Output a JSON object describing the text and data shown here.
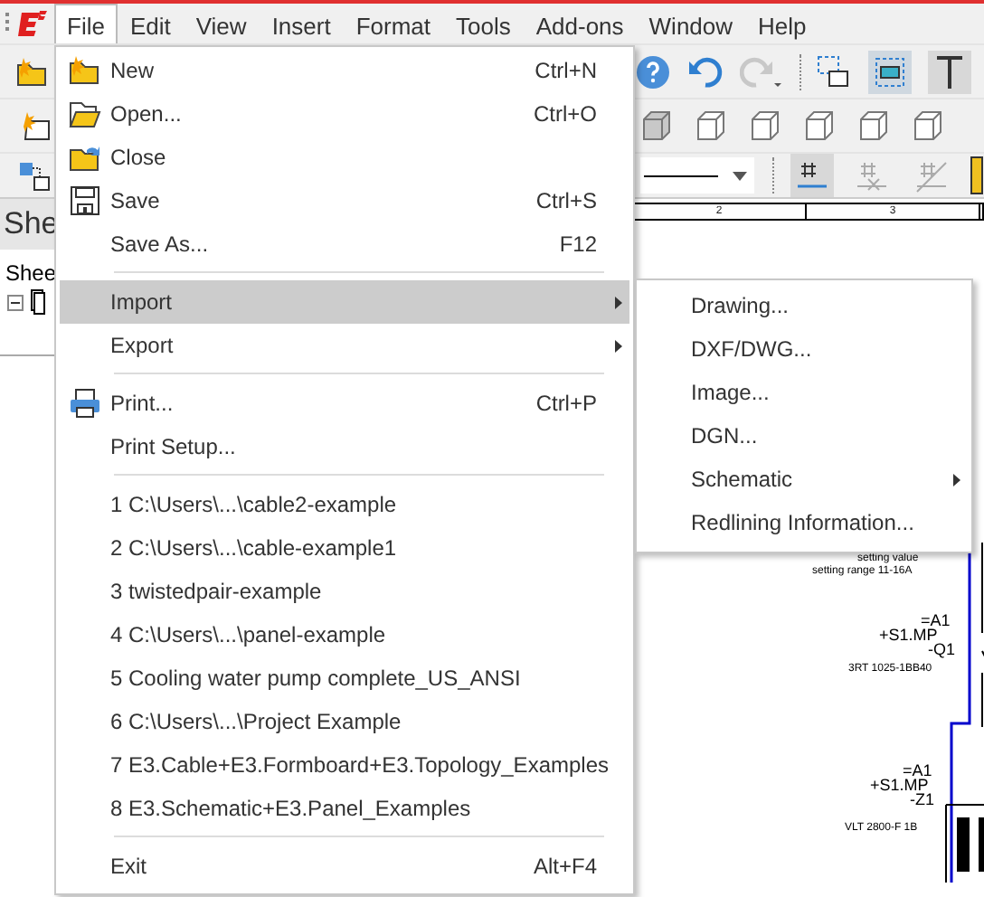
{
  "menubar": [
    {
      "label": "File",
      "selected": true
    },
    {
      "label": "Edit",
      "selected": false
    },
    {
      "label": "View",
      "selected": false
    },
    {
      "label": "Insert",
      "selected": false
    },
    {
      "label": "Format",
      "selected": false
    },
    {
      "label": "Tools",
      "selected": false
    },
    {
      "label": "Add-ons",
      "selected": false
    },
    {
      "label": "Window",
      "selected": false
    },
    {
      "label": "Help",
      "selected": false
    }
  ],
  "side_panel": {
    "title": "She",
    "tab": "Shee"
  },
  "schematic": {
    "ruler": [
      "2",
      "3"
    ],
    "labels": [
      {
        "text": "setting value"
      },
      {
        "text": "setting range 11-16A"
      },
      {
        "text": "=A1"
      },
      {
        "text": "+S1.MP"
      },
      {
        "text": "-Q1"
      },
      {
        "text": "3RT 1025-1BB40"
      },
      {
        "text": "=A1"
      },
      {
        "text": "+S1.MP"
      },
      {
        "text": "-Z1"
      },
      {
        "text": "VLT 2800-F 1B"
      }
    ]
  },
  "file_menu": [
    {
      "kind": "item",
      "label": "New",
      "shortcut": "Ctrl+N",
      "submenu": false,
      "selected": false
    },
    {
      "kind": "item",
      "label": "Open...",
      "shortcut": "Ctrl+O",
      "submenu": false,
      "selected": false
    },
    {
      "kind": "item",
      "label": "Close",
      "submenu": false,
      "selected": false
    },
    {
      "kind": "item",
      "label": "Save",
      "shortcut": "Ctrl+S",
      "submenu": false,
      "selected": false
    },
    {
      "kind": "item",
      "label": "Save As...",
      "shortcut": "F12",
      "submenu": false,
      "selected": false
    },
    {
      "kind": "separator"
    },
    {
      "kind": "item",
      "label": "Import",
      "submenu": true,
      "selected": true
    },
    {
      "kind": "item",
      "label": "Export",
      "submenu": true,
      "selected": false
    },
    {
      "kind": "separator"
    },
    {
      "kind": "item",
      "label": "Print...",
      "shortcut": "Ctrl+P",
      "submenu": false,
      "selected": false
    },
    {
      "kind": "item",
      "label": "Print Setup...",
      "submenu": false,
      "selected": false
    },
    {
      "kind": "separator"
    },
    {
      "kind": "item",
      "label": "1 C:\\Users\\...\\cable2-example",
      "submenu": false,
      "selected": false
    },
    {
      "kind": "item",
      "label": "2 C:\\Users\\...\\cable-example1",
      "submenu": false,
      "selected": false
    },
    {
      "kind": "item",
      "label": "3 twistedpair-example",
      "submenu": false,
      "selected": false
    },
    {
      "kind": "item",
      "label": "4 C:\\Users\\...\\panel-example",
      "submenu": false,
      "selected": false
    },
    {
      "kind": "item",
      "label": "5 Cooling water pump complete_US_ANSI",
      "submenu": false,
      "selected": false
    },
    {
      "kind": "item",
      "label": "6 C:\\Users\\...\\Project Example",
      "submenu": false,
      "selected": false
    },
    {
      "kind": "item",
      "label": "7 E3.Cable+E3.Formboard+E3.Topology_Examples",
      "submenu": false,
      "selected": false
    },
    {
      "kind": "item",
      "label": "8 E3.Schematic+E3.Panel_Examples",
      "submenu": false,
      "selected": false
    },
    {
      "kind": "separator"
    },
    {
      "kind": "item",
      "label": "Exit",
      "shortcut": "Alt+F4",
      "submenu": false,
      "selected": false
    }
  ],
  "import_submenu": [
    {
      "label": "Drawing...",
      "submenu": false
    },
    {
      "label": "DXF/DWG...",
      "submenu": false
    },
    {
      "label": "Image...",
      "submenu": false
    },
    {
      "label": "DGN...",
      "submenu": false
    },
    {
      "label": "Schematic",
      "submenu": true
    },
    {
      "label": "Redlining Information...",
      "submenu": false
    }
  ]
}
